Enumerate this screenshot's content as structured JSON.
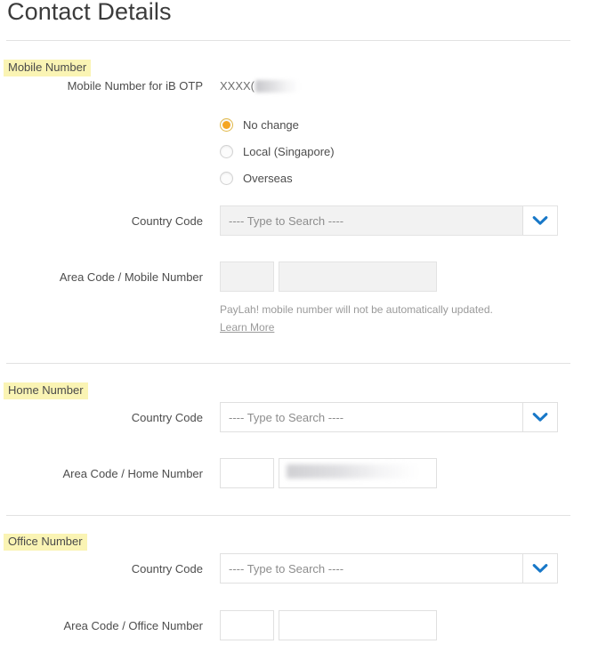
{
  "page": {
    "title": "Contact Details"
  },
  "sections": {
    "mobile": {
      "heading": "Mobile Number",
      "otp_label": "Mobile Number for iB OTP",
      "otp_value": "XXXX(",
      "radio_options": [
        {
          "label": "No change",
          "selected": true
        },
        {
          "label": "Local (Singapore)",
          "selected": false
        },
        {
          "label": "Overseas",
          "selected": false
        }
      ],
      "country_code_label": "Country Code",
      "country_code_placeholder": "---- Type to Search ----",
      "area_number_label": "Area Code / Mobile Number",
      "area_code_value": "",
      "number_value": "",
      "note_text": "PayLah! mobile number will not be automatically updated.",
      "note_link": "Learn More"
    },
    "home": {
      "heading": "Home Number",
      "country_code_label": "Country Code",
      "country_code_placeholder": "---- Type to Search ----",
      "area_number_label": "Area Code / Home Number",
      "area_code_value": "",
      "number_value": ""
    },
    "office": {
      "heading": "Office Number",
      "country_code_label": "Country Code",
      "country_code_placeholder": "---- Type to Search ----",
      "area_number_label": "Area Code / Office Number",
      "area_code_value": "",
      "number_value": ""
    }
  },
  "icons": {
    "dropdown_chevron": "chevron-down-icon"
  },
  "colors": {
    "highlight": "#faf4b4",
    "radio_selected": "#f5a623",
    "chevron_blue": "#1878c8",
    "text": "#4d4d4d",
    "placeholder": "#8d8d8d",
    "disabled_bg": "#f2f2f2",
    "border": "#e0e0e0",
    "divider": "#e2e2e2"
  }
}
